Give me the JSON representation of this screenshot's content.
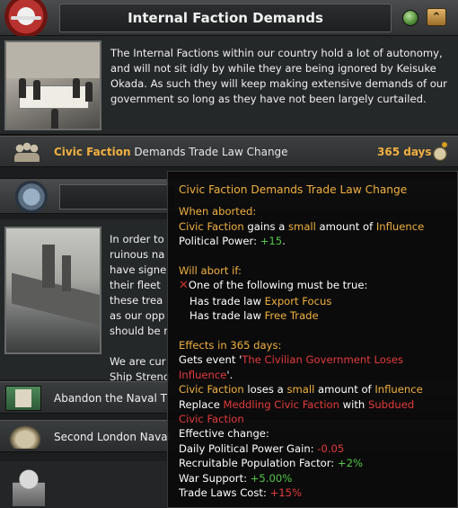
{
  "header": {
    "title": "Internal Faction Demands",
    "collapse_glyph": "⌃"
  },
  "description": {
    "text": "The Internal Factions within our country hold a lot of autonomy, and will not sit idly by while they are being ignored by Keisuke Okada. As such they will keep making extensive demands of our government so long as they have not been largely curtailed."
  },
  "mission": {
    "faction": "Civic Faction",
    "rest": " Demands Trade Law Change",
    "days": "365 days"
  },
  "naval": {
    "lines": [
      "In order to",
      "ruinous na",
      "have signe",
      "their fleet",
      "these trea",
      "as our opp",
      "should be r"
    ],
    "lines2": [
      "We are cur",
      "Ship Streng"
    ]
  },
  "decisions": {
    "abandon": "Abandon the Naval T",
    "london": "Second London Naval"
  },
  "tooltip": {
    "title": "Civic Faction Demands Trade Law Change",
    "aborted_header": "When aborted:",
    "aborted_faction": "Civic Faction",
    "aborted_gains": " gains a ",
    "aborted_small": "small",
    "aborted_amount": " amount of ",
    "aborted_influence": "Influence",
    "aborted_pp_label": "Political Power: ",
    "aborted_pp_value": "+15",
    "aborted_period": ".",
    "abort_if_header": "Will abort if:",
    "abort_x": "✕",
    "abort_one_of": "One of the following must be true:",
    "abort_law1_pre": "Has trade law ",
    "abort_law1": "Export Focus",
    "abort_law2_pre": "Has trade law ",
    "abort_law2": "Free Trade",
    "effects_header": "Effects in 365 days:",
    "event_pre": "Gets event '",
    "event_name_1": "The Civilian Government Loses",
    "event_name_2": "Influence",
    "event_post": "'.",
    "loses_faction": "Civic Faction",
    "loses_text": " loses a ",
    "loses_small": "small",
    "loses_amount": " amount of ",
    "loses_influence": "Influence",
    "replace_pre": "Replace ",
    "replace_old": "Meddling",
    "replace_old_faction": " Civic Faction",
    "replace_with": " with ",
    "replace_new": "Subdued",
    "replace_new_faction": "Civic Faction",
    "effective_change": "Effective change:",
    "stat1_label": "Daily Political Power Gain: ",
    "stat1_value": "-0.05",
    "stat2_label": "Recruitable Population Factor: ",
    "stat2_value": "+2%",
    "stat3_label": "War Support: ",
    "stat3_value": "+5.00%",
    "stat4_label": "Trade Laws Cost: ",
    "stat4_value": "+15%"
  }
}
